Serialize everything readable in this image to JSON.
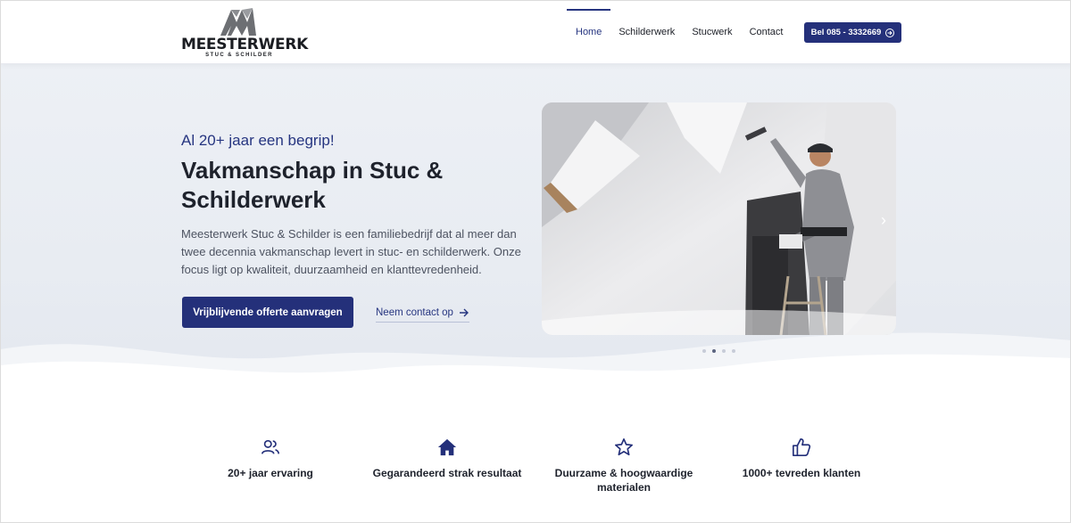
{
  "brand": {
    "name": "MEESTERWERK",
    "tagline": "STUC & SCHILDER"
  },
  "nav": {
    "items": [
      "Home",
      "Schilderwerk",
      "Stucwerk",
      "Contact"
    ],
    "active": "Home",
    "call_label": "Bel 085 - 3332669"
  },
  "hero": {
    "kicker": "Al 20+ jaar een begrip!",
    "title": "Vakmanschap in Stuc & Schilderwerk",
    "description": "Meesterwerk Stuc & Schilder is een familiebedrijf dat al meer dan twee decennia vakmanschap levert in stuc- en schilderwerk. Onze focus ligt op kwaliteit, duurzaamheid en klanttevredenheid.",
    "primary_cta": "Vrijblijvende offerte aanvragen",
    "secondary_cta": "Neem contact op",
    "slider": {
      "slide_count": 4,
      "active_index": 1
    }
  },
  "features": [
    {
      "icon": "users-icon",
      "label": "20+ jaar ervaring"
    },
    {
      "icon": "home-icon",
      "label": "Gegarandeerd strak resultaat"
    },
    {
      "icon": "star-icon",
      "label": "Duurzame & hoogwaardige materialen"
    },
    {
      "icon": "thumbs-up-icon",
      "label": "1000+ tevreden klanten"
    }
  ],
  "colors": {
    "primary": "#24307a",
    "accent_text": "#263580",
    "hero_bg": "#eceff4"
  }
}
